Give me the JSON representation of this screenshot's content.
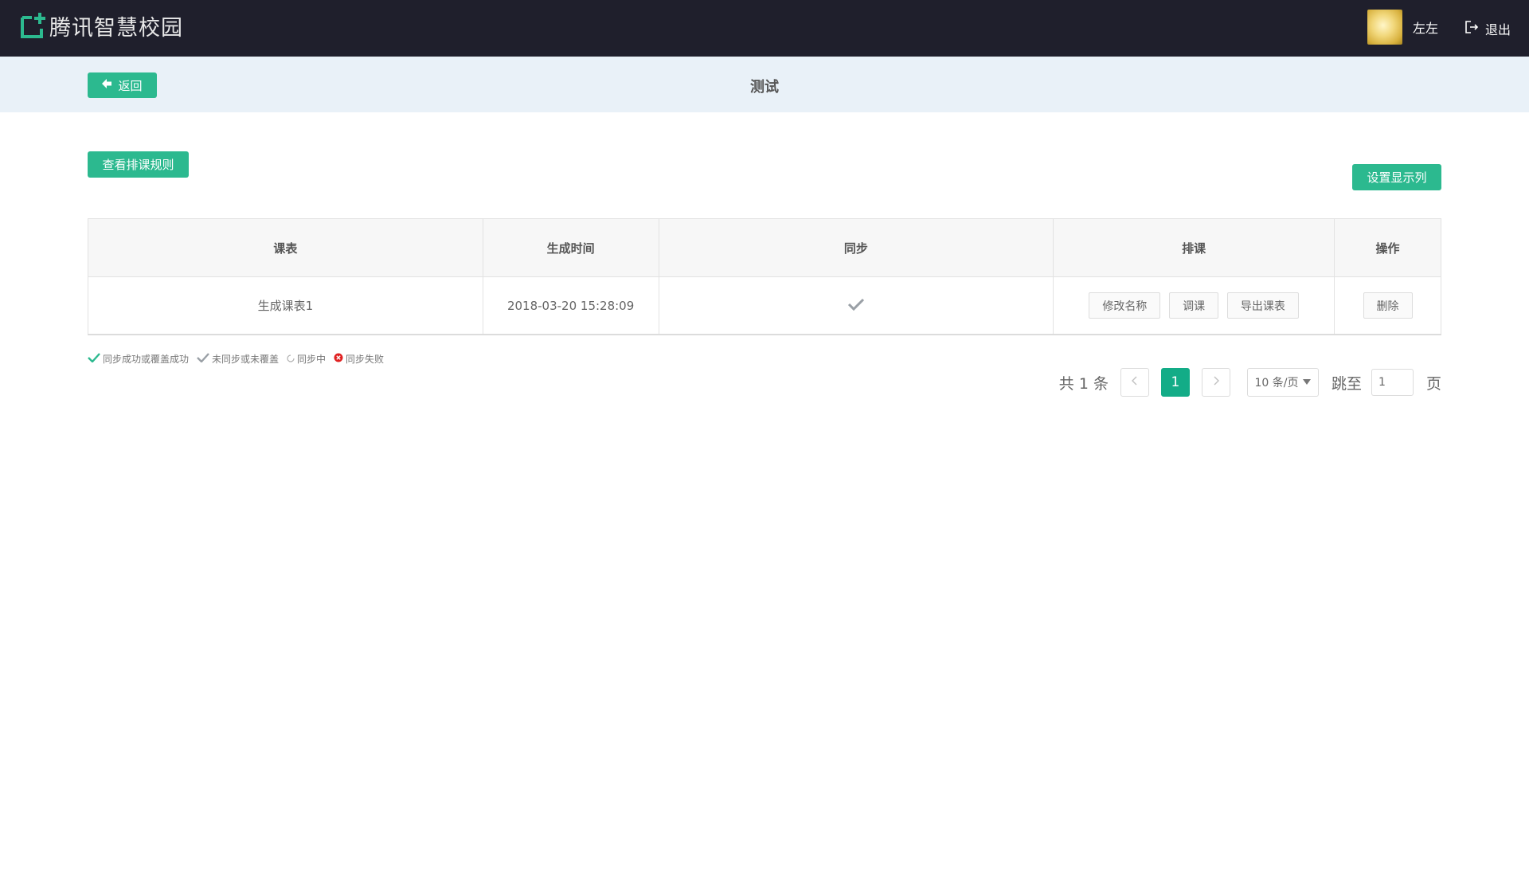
{
  "header": {
    "logo_text": "腾讯智慧校园",
    "username": "左左",
    "logout_label": "退出"
  },
  "subheader": {
    "back_label": "返回",
    "title": "测试"
  },
  "toolbar": {
    "rules_label": "查看排课规则",
    "set_columns_label": "设置显示列"
  },
  "table": {
    "columns": [
      "课表",
      "生成时间",
      "同步",
      "排课",
      "操作"
    ],
    "rows": [
      {
        "name": "生成课表1",
        "time": "2018-03-20 15:28:09",
        "sync_status": "check-icon",
        "actions": [
          "修改名称",
          "调课",
          "导出课表"
        ],
        "op": "删除"
      }
    ]
  },
  "legend": {
    "items": [
      "同步成功或覆盖成功",
      "未同步或未覆盖",
      "同步中",
      "同步失败"
    ]
  },
  "pagination": {
    "total_text": "共 1 条",
    "current_page": "1",
    "page_size": "10 条/页",
    "jump_label": "跳至",
    "jump_value": "1",
    "page_suffix": "页"
  },
  "colors": {
    "accent": "#2cb98f",
    "topbar": "#1f1f2c",
    "subbar": "#e9f1f8",
    "fail": "#e02020"
  }
}
